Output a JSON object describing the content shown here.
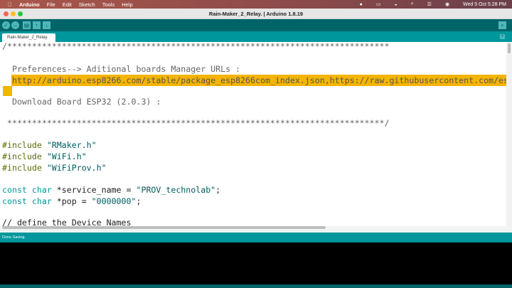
{
  "menubar": {
    "app": "Arduino",
    "items": [
      "File",
      "Edit",
      "Sketch",
      "Tools",
      "Help"
    ],
    "clock": "Wed 5 Oct  5:28 PM"
  },
  "window": {
    "title": "Rain-Maker_2_Relay. | Arduino 1.8.19"
  },
  "tabs": [
    {
      "label": "Rain-Maker_2_Relay."
    }
  ],
  "editor": {
    "lines": [
      "/*****************************************************************************",
      "  Preferences--> Aditional boards Manager URLs :",
      "  http://arduino.esp8266.com/stable/package_esp8266com_index.json,https://raw.githubusercontent.com/es",
      "  Download Board ESP32 (2.0.3) :",
      " ****************************************************************************/",
      "// define the Device Names"
    ],
    "includes": [
      "\"RMaker.h\"",
      "\"WiFi.h\"",
      "\"WiFiProv.h\""
    ],
    "include_kw": "#include",
    "const_kw": "const char",
    "decl1_name": " *service_name = ",
    "decl1_val": "\"PROV_technolab\"",
    "decl2_name": " *pop = ",
    "decl2_val": "\"0000000\"",
    "semi": ";"
  },
  "status": {
    "message": "Done Saving."
  },
  "colors": {
    "toolbar": "#006468",
    "accent": "#00979c",
    "highlight": "#f5b400"
  }
}
